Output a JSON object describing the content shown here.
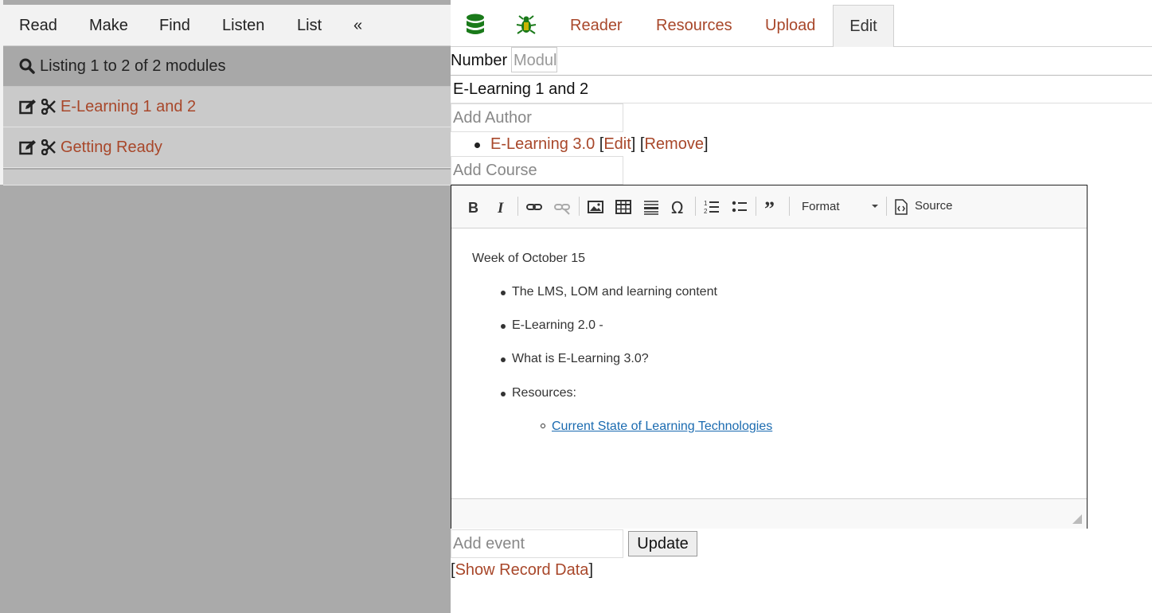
{
  "left_nav": {
    "items": [
      "Read",
      "Make",
      "Find",
      "Listen",
      "List",
      "«"
    ]
  },
  "listing": {
    "text": "Listing 1 to 2 of 2 modules"
  },
  "modules": [
    {
      "title": "E-Learning 1 and 2"
    },
    {
      "title": "Getting Ready"
    }
  ],
  "tabs": {
    "reader": "Reader",
    "resources": "Resources",
    "upload": "Upload",
    "edit": "Edit"
  },
  "form": {
    "number_label": "Number",
    "number_placeholder": "Modul",
    "title_value": "E-Learning 1 and 2",
    "add_author_placeholder": "Add Author",
    "author": {
      "name": "E-Learning 3.0",
      "edit": "Edit",
      "remove": "Remove"
    },
    "add_course_placeholder": "Add Course",
    "add_event_placeholder": "Add  event",
    "update_label": "Update",
    "show_record": "Show Record Data"
  },
  "editor": {
    "toolbar": {
      "format_label": "Format",
      "source_label": "Source"
    },
    "content": {
      "heading": "Week of October 15",
      "items": [
        "The LMS, LOM and learning content",
        "E-Learning 2.0 -",
        "What is E-Learning 3.0?",
        "Resources:"
      ],
      "sub_link": "Current State of Learning Technologies"
    }
  },
  "colors": {
    "link": "#a8472a",
    "sidebar_bg": "#aaaaaa",
    "row_bg": "#cacaca",
    "editor_link": "#1b6bb0"
  }
}
